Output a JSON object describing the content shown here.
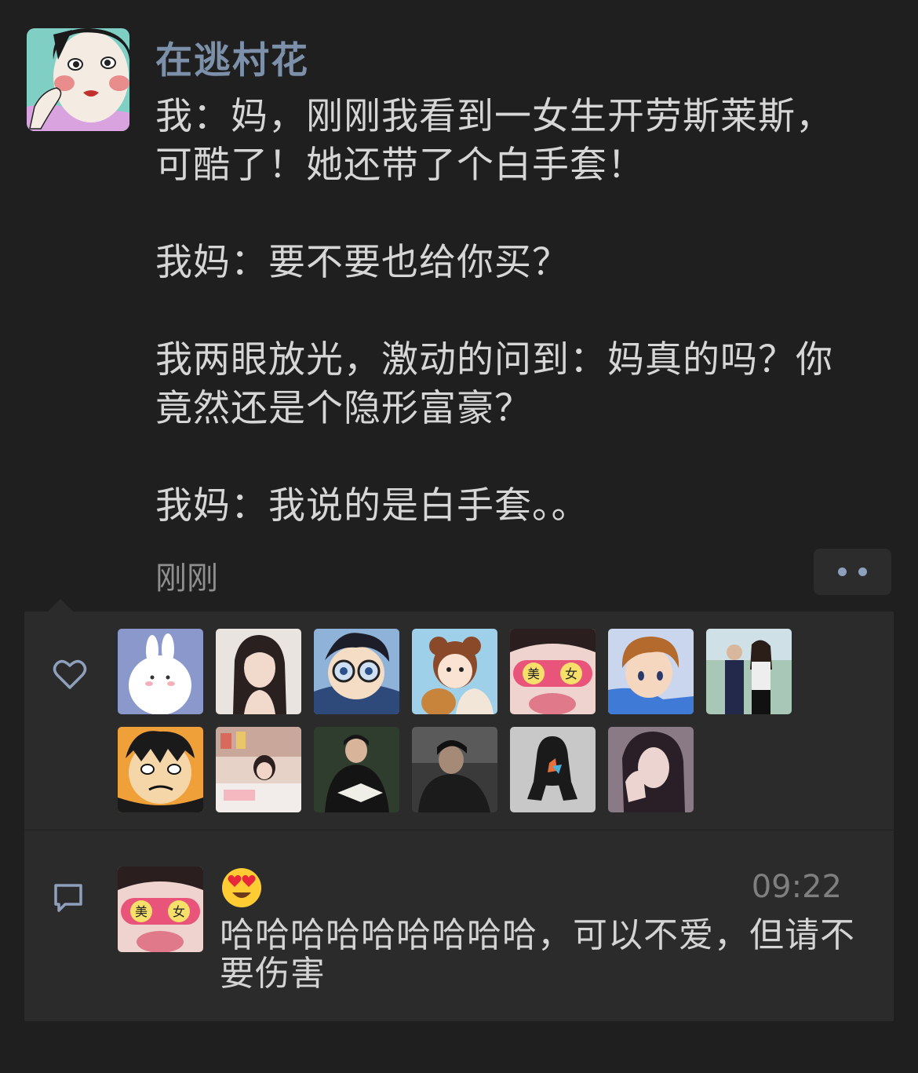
{
  "post": {
    "author": "在逃村花",
    "paragraphs": [
      "我：妈，刚刚我看到一女生开劳斯莱斯，可酷了！她还带了个白手套！",
      "我妈：要不要也给你买？",
      "我两眼放光，激动的问到：妈真的吗？你竟然还是个隐形富豪？",
      "我妈：我说的是白手套。。"
    ],
    "time": "刚刚"
  },
  "likes": {
    "icon": "heart-outline-icon",
    "avatars": [
      "avatar-cartoon-bunny",
      "avatar-girl-long-hair",
      "avatar-anime-boy-glasses",
      "avatar-cartoon-girl-bear",
      "avatar-girl-pink-glasses",
      "avatar-anime-boy-blue",
      "avatar-couple-photo",
      "avatar-anime-pirate",
      "avatar-girl-reading-desk",
      "avatar-man-reading-book",
      "avatar-man-dark-photo",
      "avatar-hooded-figure",
      "avatar-girl-selfie"
    ]
  },
  "comment": {
    "icon": "comment-bubble-icon",
    "avatar": "avatar-girl-pink-glasses",
    "emoji": "heart-eyes-emoji",
    "time": "09:22",
    "text": "哈哈哈哈哈哈哈哈哈，可以不爱，但请不要伤害"
  },
  "colors": {
    "background": "#1f1f1f",
    "panel": "#2b2b2b",
    "author": "#7d90a9",
    "text": "#d6d6d6",
    "accent_icon": "#8ea0bb"
  }
}
